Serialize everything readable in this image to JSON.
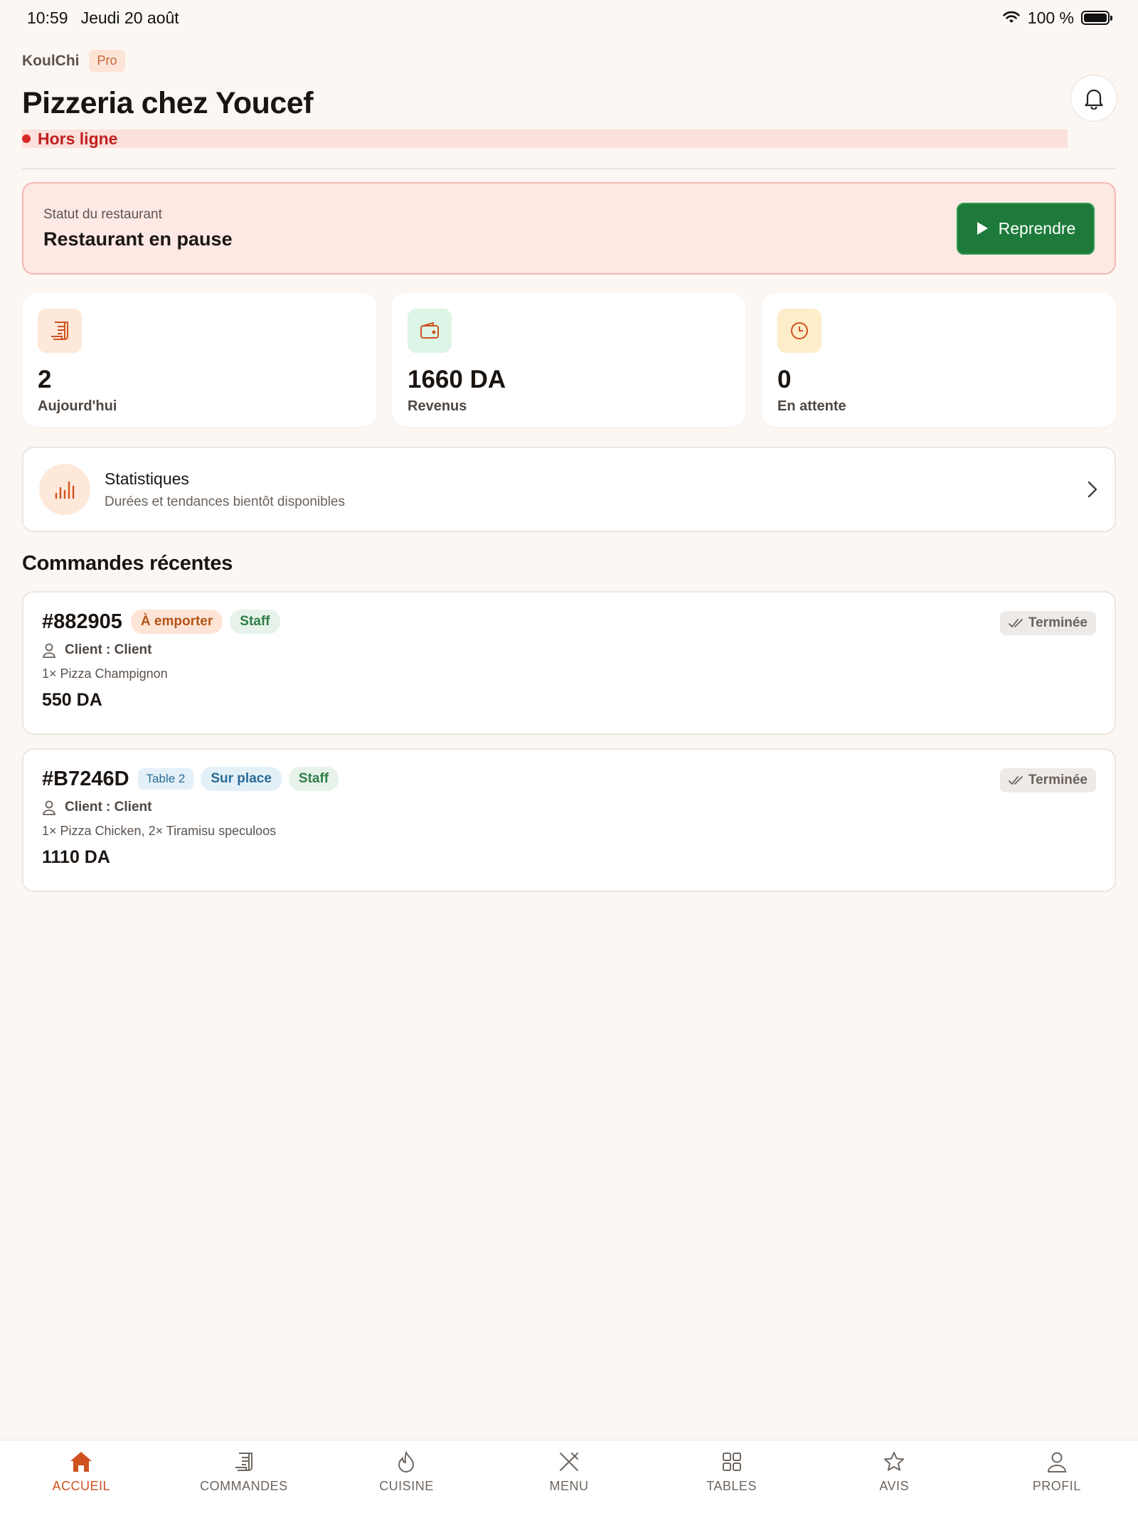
{
  "status_bar": {
    "time": "10:59",
    "date": "Jeudi 20 août",
    "battery": "100 %"
  },
  "header": {
    "brand": "KoulChi",
    "plan_badge": "Pro",
    "title": "Pizzeria chez Youcef",
    "connection_status": "Hors ligne"
  },
  "restaurant_status": {
    "label": "Statut du restaurant",
    "value": "Restaurant en pause",
    "action_label": "Reprendre"
  },
  "stats": [
    {
      "value": "2",
      "label": "Aujourd'hui",
      "icon": "receipt-icon",
      "icon_bg": "#fde8d9",
      "icon_color": "#d0521f"
    },
    {
      "value": "1660 DA",
      "label": "Revenus",
      "icon": "wallet-icon",
      "icon_bg": "#dcf5e6",
      "icon_color": "#d0521f"
    },
    {
      "value": "0",
      "label": "En attente",
      "icon": "clock-icon",
      "icon_bg": "#fdedc9",
      "icon_color": "#d0521f"
    }
  ],
  "statistics_link": {
    "title": "Statistiques",
    "subtitle": "Durées et tendances bientôt disponibles"
  },
  "recent_orders": {
    "title": "Commandes récentes",
    "orders": [
      {
        "id": "#882905",
        "tags": [
          "À emporter",
          "Staff"
        ],
        "status": "Terminée",
        "client": "Client : Client",
        "items": "1× Pizza Champignon",
        "total": "550 DA"
      },
      {
        "id": "#B7246D",
        "tags": [
          "Table 2",
          "Sur place",
          "Staff"
        ],
        "status": "Terminée",
        "client": "Client : Client",
        "items": "1× Pizza Chicken, 2× Tiramisu speculoos",
        "total": "1110 DA"
      }
    ]
  },
  "tabbar": {
    "items": [
      {
        "label": "ACCUEIL",
        "icon": "home-icon",
        "active": true
      },
      {
        "label": "COMMANDES",
        "icon": "receipt-icon",
        "active": false
      },
      {
        "label": "CUISINE",
        "icon": "flame-icon",
        "active": false
      },
      {
        "label": "MENU",
        "icon": "utensils-icon",
        "active": false
      },
      {
        "label": "TABLES",
        "icon": "grid-icon",
        "active": false
      },
      {
        "label": "AVIS",
        "icon": "star-icon",
        "active": false
      },
      {
        "label": "PROFIL",
        "icon": "user-icon",
        "active": false
      }
    ]
  },
  "colors": {
    "accent": "#d0521f",
    "resume_button": "#1d7a3a",
    "offline": "#d92727",
    "background": "#fcf7f3"
  }
}
